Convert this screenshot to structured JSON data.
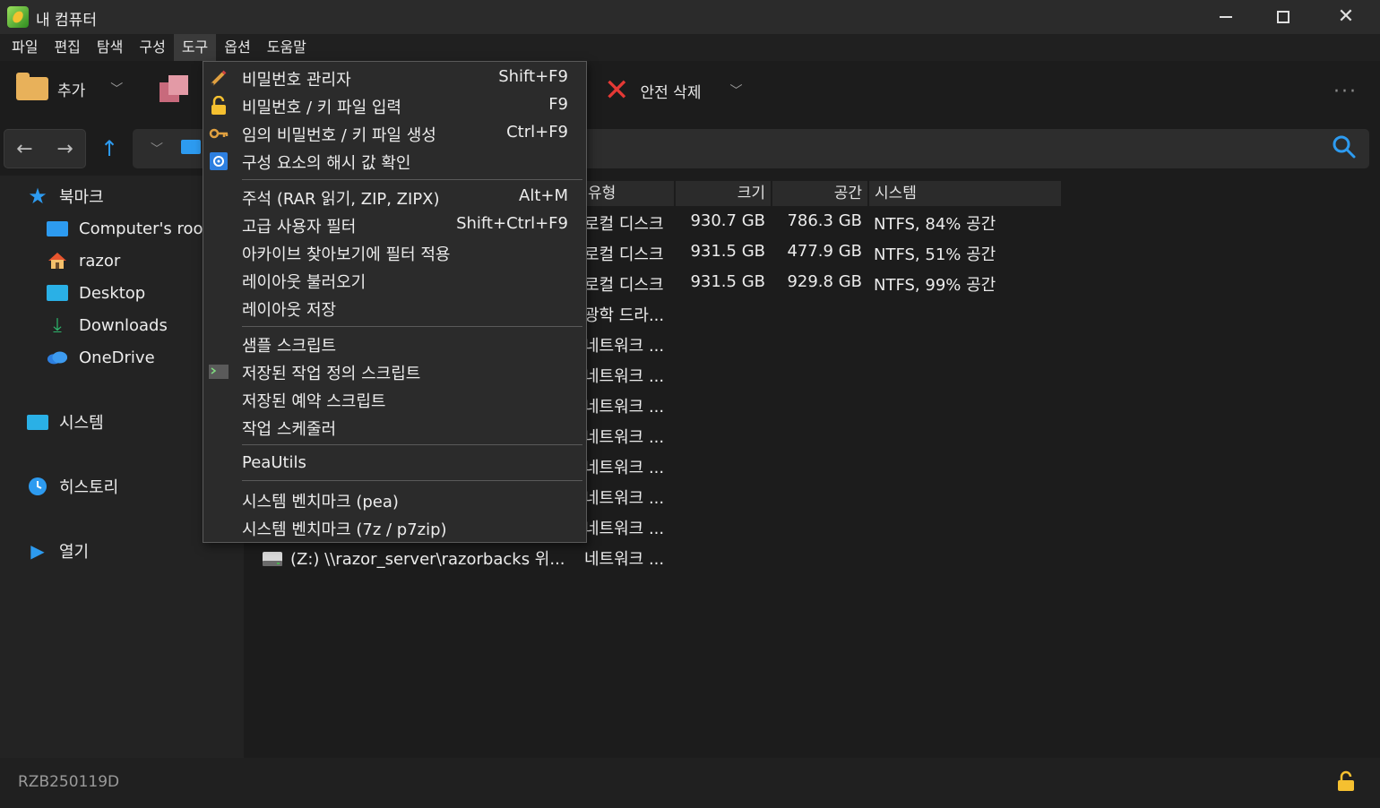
{
  "window": {
    "title": "내 컴퓨터"
  },
  "menubar": [
    "파일",
    "편집",
    "탐색",
    "구성",
    "도구",
    "옵션",
    "도움말"
  ],
  "toolbar": {
    "add_label": "추가",
    "extract_label": "",
    "secure_delete_label": "안전 삭제"
  },
  "sidebar": {
    "bookmarks": "북마크",
    "items": [
      "Computer's roo",
      "razor",
      "Desktop",
      "Downloads",
      "OneDrive"
    ],
    "system": "시스템",
    "history": "히스토리",
    "open": "열기"
  },
  "table": {
    "headers": {
      "type": "유형",
      "size": "크기",
      "free": "공간",
      "system": "시스템"
    },
    "rows": [
      {
        "type": "로컬 디스크",
        "size": "930.7 GB",
        "free": "786.3 GB",
        "system": "NTFS, 84% 공간"
      },
      {
        "type": "로컬 디스크",
        "size": "931.5 GB",
        "free": "477.9 GB",
        "system": "NTFS, 51% 공간"
      },
      {
        "type": "로컬 디스크",
        "size": "931.5 GB",
        "free": "929.8 GB",
        "system": "NTFS, 99% 공간"
      },
      {
        "type": "광학 드라..."
      },
      {
        "type": "네트워크 ..."
      },
      {
        "type": "네트워크 ..."
      },
      {
        "type": "네트워크 ..."
      },
      {
        "type": "네트워크 ..."
      },
      {
        "type": "네트워크 ..."
      },
      {
        "type": "네트워크 ..."
      },
      {
        "type": "네트워크 ..."
      },
      {
        "name": "(Z:) \\\\razor_server\\razorbacks 위...",
        "type": "네트워크 ..."
      }
    ]
  },
  "dropdown": {
    "items": [
      {
        "label": "비밀번호 관리자",
        "shortcut": "Shift+F9"
      },
      {
        "label": "비밀번호 / 키 파일 입력",
        "shortcut": "F9"
      },
      {
        "label": "임의 비밀번호 / 키 파일 생성",
        "shortcut": "Ctrl+F9"
      },
      {
        "label": "구성 요소의 해시 값 확인",
        "shortcut": ""
      },
      {
        "label": "주석 (RAR 읽기, ZIP, ZIPX)",
        "shortcut": "Alt+M"
      },
      {
        "label": "고급 사용자 필터",
        "shortcut": "Shift+Ctrl+F9"
      },
      {
        "label": "아카이브 찾아보기에 필터 적용",
        "shortcut": ""
      },
      {
        "label": "레이아웃 불러오기",
        "shortcut": ""
      },
      {
        "label": "레이아웃 저장",
        "shortcut": ""
      },
      {
        "label": "샘플 스크립트",
        "shortcut": ""
      },
      {
        "label": "저장된 작업 정의 스크립트",
        "shortcut": ""
      },
      {
        "label": "저장된 예약 스크립트",
        "shortcut": ""
      },
      {
        "label": "작업 스케줄러",
        "shortcut": ""
      },
      {
        "label": "PeaUtils",
        "shortcut": ""
      },
      {
        "label": "시스템 벤치마크 (pea)",
        "shortcut": ""
      },
      {
        "label": "시스템 벤치마크 (7z / p7zip)",
        "shortcut": ""
      }
    ]
  },
  "status": {
    "text": "RZB250119D"
  },
  "colors": {
    "accent": "#2d9bf0",
    "danger": "#e53935",
    "folder": "#e8b15a"
  }
}
